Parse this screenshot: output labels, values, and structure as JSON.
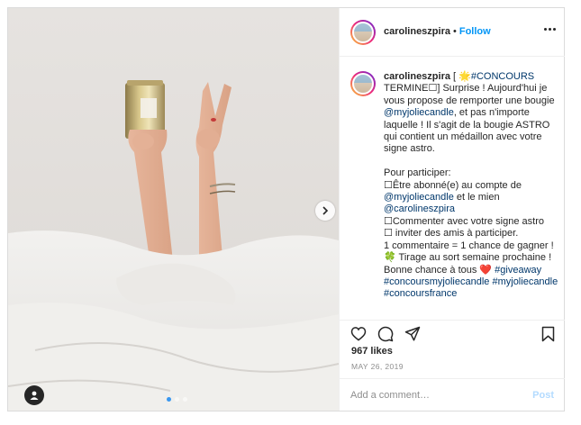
{
  "post": {
    "username": "carolineszpira",
    "header_separator": "•",
    "follow_label": "Follow",
    "caption_user": "carolineszpira",
    "caption_segments": [
      {
        "text": " [ 🌟",
        "style": "plain"
      },
      {
        "text": "#CONCOURS",
        "style": "link"
      },
      {
        "text": " TERMINE☐] Surprise ! Aujourd'hui je vous propose de remporter une bougie ",
        "style": "plain"
      },
      {
        "text": "@myjoliecandle",
        "style": "link"
      },
      {
        "text": ", et pas n'importe laquelle ! Il s'agit de la bougie ASTRO qui contient un médaillon avec votre signe astro.\n\nPour participer:\n☐Être abonné(e) au compte de ",
        "style": "plain"
      },
      {
        "text": "@myjoliecandle",
        "style": "link"
      },
      {
        "text": " et le mien ",
        "style": "plain"
      },
      {
        "text": "@carolineszpira",
        "style": "link"
      },
      {
        "text": "\n☐Commenter avec votre signe astro\n☐ inviter des amis à participer.\n1 commentaire = 1 chance de gagner ! 🍀 Tirage au sort semaine prochaine !\nBonne chance à tous ❤️ ",
        "style": "plain"
      },
      {
        "text": "#giveaway",
        "style": "link"
      },
      {
        "text": " ",
        "style": "plain"
      },
      {
        "text": "#concoursmyjoliecandle",
        "style": "link"
      },
      {
        "text": " ",
        "style": "plain"
      },
      {
        "text": "#myjoliecandle",
        "style": "link"
      },
      {
        "text": " ",
        "style": "plain"
      },
      {
        "text": "#concoursfrance",
        "style": "link"
      }
    ],
    "likes": "967 likes",
    "date": "MAY 26, 2019",
    "comment_placeholder": "Add a comment…",
    "post_label": "Post",
    "carousel": {
      "count": 3,
      "active_index": 0
    },
    "icons": [
      "heart-icon",
      "comment-icon",
      "share-icon",
      "bookmark-icon",
      "more-icon",
      "chevron-right-icon",
      "user-tag-icon"
    ]
  },
  "colors": {
    "link": "#00376b",
    "follow": "#0095f6",
    "post_disabled": "#b3dbff",
    "muted": "#8e8e8e",
    "text": "#262626"
  }
}
